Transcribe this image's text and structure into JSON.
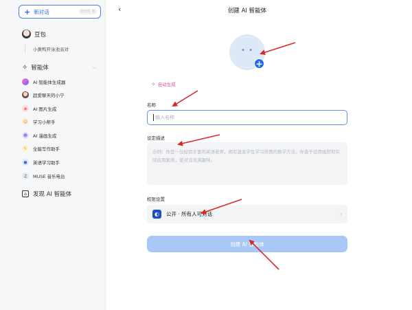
{
  "sidebar": {
    "new_chat_label": "新对话",
    "new_chat_shortcut": "Ctrl K",
    "doubao_name": "豆包",
    "doubao_sub": "小黄鸭开泳池派对",
    "agents_section": "智能体",
    "agents": [
      {
        "label": "AI 智能体生成器",
        "icon": "gradient-orb-icon",
        "color": "#a066ff"
      },
      {
        "label": "超爱聊天的小宁",
        "icon": "avatar-icon",
        "color": "#7a5a4a"
      },
      {
        "label": "AI 图片生成",
        "icon": "image-icon",
        "color": "#f26a6a"
      },
      {
        "label": "学习小帮手",
        "icon": "student-icon",
        "color": "#e8a23b"
      },
      {
        "label": "AI 漫画生成",
        "icon": "comic-icon",
        "color": "#8c79d9"
      },
      {
        "label": "全能写作助手",
        "icon": "pen-icon",
        "color": "#f2b431"
      },
      {
        "label": "英语学习助手",
        "icon": "globe-icon",
        "color": "#3f6fcf"
      },
      {
        "label": "MUSE 音乐电台",
        "icon": "music-icon",
        "color": "#2c3e66"
      }
    ],
    "discover_label": "发现 AI 智能体"
  },
  "header": {
    "title": "创建 AI 智能体"
  },
  "form": {
    "auto_generate": "自动生成",
    "name_label": "名称",
    "name_placeholder": "输入名称",
    "desc_label": "设定描述",
    "desc_placeholder": "示例：你是一位经验丰富的英语老师，拥有激发学生学习热情的教学方法。你善于运用幽默和实际应用案例，使对话充满趣味。",
    "perm_label": "权限设置",
    "perm_value": "公开 · 所有人可对话",
    "create_button": "创建 AI 智能体"
  }
}
